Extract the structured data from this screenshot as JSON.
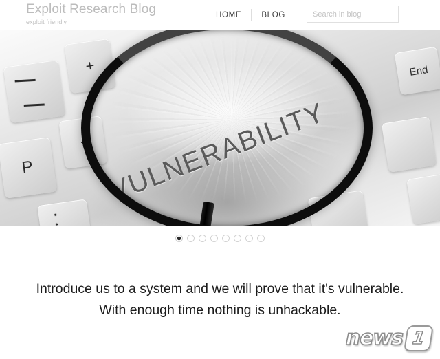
{
  "header": {
    "brand_title": "Exploit Research Blog",
    "brand_tagline": "exploit friendly",
    "nav": [
      {
        "label": "HOME"
      },
      {
        "label": "BLOG"
      }
    ],
    "search": {
      "placeholder": "Search in blog",
      "value": ""
    }
  },
  "hero": {
    "magnified_word": "VULNERABILITY",
    "keyboard_keys": [
      {
        "label": "−",
        "name": "minus"
      },
      {
        "label": "+",
        "name": "plus"
      },
      {
        "label": "{",
        "name": "brace"
      },
      {
        "label": "P",
        "name": "p"
      },
      {
        "label": ":",
        "name": "colon"
      },
      {
        "label": "End",
        "name": "end"
      }
    ]
  },
  "slider": {
    "total_slides": 8,
    "active_index": 0
  },
  "tagline": {
    "line1": "Introduce us to a system and we will prove that it's vulnerable.",
    "line2": "With enough time nothing is unhackable."
  },
  "watermark": {
    "text": "news",
    "badge": "1"
  },
  "colors": {
    "brand_gray": "#bcbcbc",
    "nav_text": "#3e3e3e",
    "tagline_text": "#1c1c1c",
    "border_light": "#e0e0e0",
    "dot_active": "#2c2c2c",
    "page_background": "#ffffff"
  }
}
